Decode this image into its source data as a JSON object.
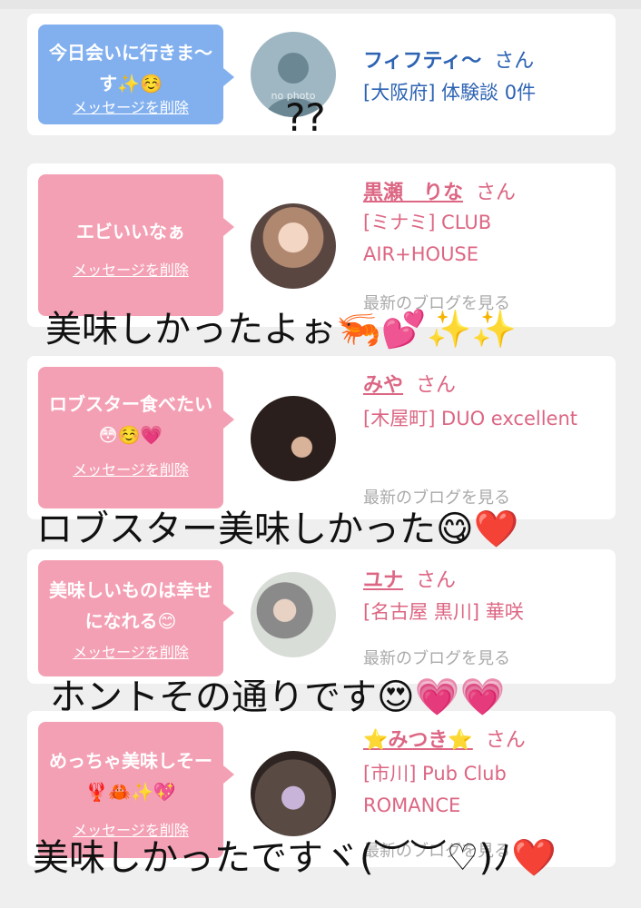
{
  "cards": [
    {
      "message": "今日会いに行きま〜す✨☺️",
      "delete_label": "メッセージを削除",
      "name": "フィフティ〜",
      "honorific": "さん",
      "info": "[大阪府] 体験談 0件",
      "avatar_text": "no photo",
      "theme": "blue"
    },
    {
      "message": "エビいいなぁ",
      "delete_label": "メッセージを削除",
      "name": "黒瀬　りな",
      "honorific": "さん",
      "info": "[ミナミ] CLUB AIR+HOUSE",
      "blog_link": "最新のブログを見る",
      "theme": "pink"
    },
    {
      "message": "ロブスター食べたい😳☺️💗",
      "delete_label": "メッセージを削除",
      "name": "みや",
      "honorific": "さん",
      "info": "[木屋町] DUO excellent",
      "blog_link": "最新のブログを見る",
      "theme": "pink"
    },
    {
      "message": "美味しいものは幸せになれる😊",
      "delete_label": "メッセージを削除",
      "name": "ユナ",
      "honorific": "さん",
      "info": "[名古屋 黒川] 華咲",
      "blog_link": "最新のブログを見る",
      "theme": "pink"
    },
    {
      "message": "めっちゃ美味しそー🦞🦀✨💖",
      "delete_label": "メッセージを削除",
      "name": "⭐みつき⭐",
      "honorific": "さん",
      "info": "[市川] Pub Club ROMANCE",
      "blog_link": "最新のブログを見る",
      "theme": "pink"
    }
  ],
  "annotations": {
    "q": "??",
    "a1": "美味しかったよぉ🦐💕✨✨",
    "a2": "ロブスター美味しかった😋❤️",
    "a3": "ホントその通りです😍💗💗",
    "a4": "美味しかったですヾ(︶︶♡)ﾉ❤️"
  },
  "colors": {
    "blue_bubble": "#82b0ef",
    "pink_bubble": "#f4a0b4",
    "blue_text": "#2d63b3",
    "pink_text": "#dc6683",
    "background": "#f0eff0"
  }
}
